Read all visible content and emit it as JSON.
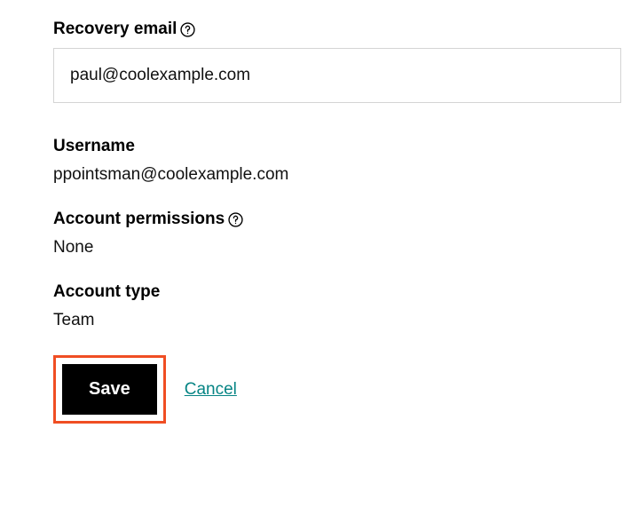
{
  "recovery_email": {
    "label": "Recovery email",
    "value": "paul@coolexample.com"
  },
  "username": {
    "label": "Username",
    "value": "ppointsman@coolexample.com"
  },
  "permissions": {
    "label": "Account permissions",
    "value": "None"
  },
  "account_type": {
    "label": "Account type",
    "value": "Team"
  },
  "actions": {
    "save_label": "Save",
    "cancel_label": "Cancel"
  }
}
